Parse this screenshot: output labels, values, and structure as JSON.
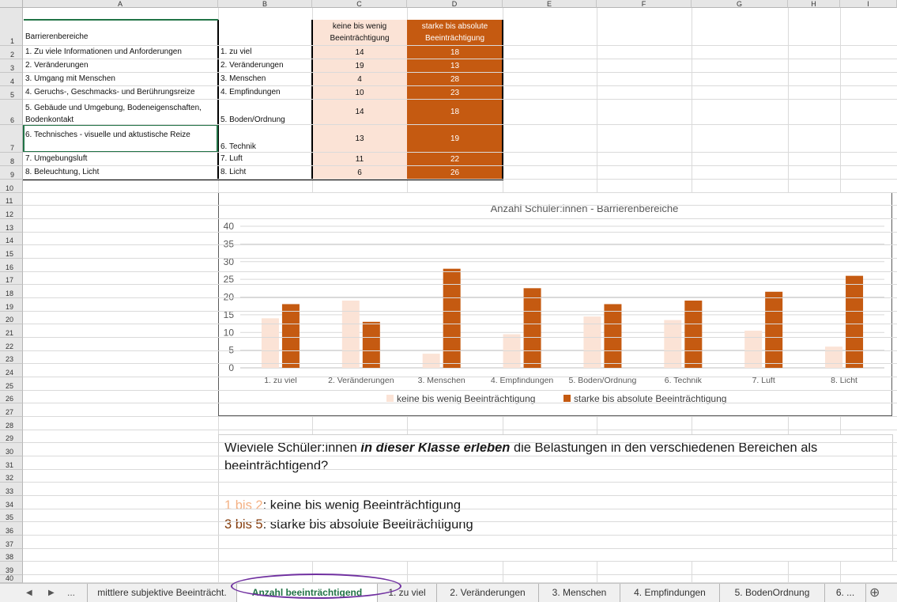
{
  "spreadsheet": {
    "columns": [
      "A",
      "B",
      "C",
      "D",
      "E",
      "F",
      "G",
      "H",
      "I"
    ],
    "rows": [
      "1",
      "2",
      "3",
      "4",
      "5",
      "6",
      "7",
      "8",
      "9",
      "10",
      "11",
      "12",
      "13",
      "14",
      "15",
      "16",
      "17",
      "18",
      "19",
      "20",
      "21",
      "22",
      "23",
      "24",
      "25",
      "26",
      "27",
      "28",
      "29",
      "30",
      "31",
      "32",
      "33",
      "34",
      "35",
      "36",
      "37",
      "38",
      "39",
      "40"
    ],
    "header": {
      "a": "Barrierenbereiche",
      "c_line1": "keine bis wenig",
      "c_line2": "Beeinträchtigung",
      "d_line1": "starke  bis absolute",
      "d_line2": "Beeinträchtigung"
    },
    "data_rows": [
      {
        "a": "1. Zu viele Informationen und Anforderungen",
        "b": "1. zu viel",
        "c": "14",
        "d": "18"
      },
      {
        "a": "2. Veränderungen",
        "b": "2. Veränderungen",
        "c": "19",
        "d": "13"
      },
      {
        "a": "3. Umgang mit Menschen",
        "b": "3. Menschen",
        "c": "4",
        "d": "28"
      },
      {
        "a": "4. Geruchs-, Geschmacks- und Berührungsreize",
        "b": "4. Empfindungen",
        "c": "10",
        "d": "23"
      },
      {
        "a": "5. Gebäude und Umgebung, Bodeneigenschaften, Bodenkontakt",
        "b": "5. Boden/Ordnung",
        "c": "14",
        "d": "18"
      },
      {
        "a": "6. Technisches - visuelle und aktustische Reize",
        "b": "6. Technik",
        "c": "13",
        "d": "19"
      },
      {
        "a": "7. Umgebungsluft",
        "b": "7. Luft",
        "c": "11",
        "d": "22"
      },
      {
        "a": "8. Beleuchtung, Licht",
        "b": "8. Licht",
        "c": "6",
        "d": "26"
      }
    ]
  },
  "chart_data": {
    "type": "bar",
    "title": "Anzahl Schüler:innen - Barrierenbereiche",
    "categories": [
      "1. zu viel",
      "2. Veränderungen",
      "3. Menschen",
      "4. Empfindungen",
      "5. Boden/Ordnung",
      "6. Technik",
      "7. Luft",
      "8. Licht"
    ],
    "series": [
      {
        "name": "keine bis wenig Beeinträchtigung",
        "values": [
          14,
          19,
          4,
          9.5,
          14.5,
          13.5,
          10.5,
          6
        ],
        "color": "#fbe3d6"
      },
      {
        "name": "starke  bis absolute Beeinträchtigung",
        "values": [
          18,
          13,
          28,
          22.5,
          18,
          19,
          21.5,
          26
        ],
        "color": "#c55a11"
      }
    ],
    "ylim": [
      0,
      40
    ],
    "yticks": [
      "0",
      "5",
      "10",
      "15",
      "20",
      "25",
      "30",
      "35",
      "40"
    ],
    "grid": true,
    "legend_position": "bottom"
  },
  "textbox": {
    "question_pre": "Wieviele Schüler:innen ",
    "question_emph": "in dieser Klasse erleben",
    "question_post": " die Belastungen in den verschiedenen Bereichen als beeinträchtigend?",
    "line1_range": "1 bis 2",
    "line1_text": ": keine bis wenig Beeinträchtigung",
    "line2_range": "3 bis 5",
    "line2_text": ": starke bis absolute Beeiträchtigung",
    "color_light": "#f4b183",
    "color_dark": "#843c0c"
  },
  "tabs": {
    "nav_prev": "◀",
    "nav_next": "▶",
    "nav_more": "...",
    "items": [
      "mittlere subjektive Beeinträcht.",
      "Anzahl beeinträchtigend",
      "1. zu viel",
      "2. Veränderungen",
      "3. Menschen",
      "4. Empfindungen",
      "5. BodenOrdnung",
      "6. ..."
    ],
    "add": "⊕"
  },
  "colors": {
    "active_tab": "#217346",
    "highlight_circle": "#7030a0"
  }
}
